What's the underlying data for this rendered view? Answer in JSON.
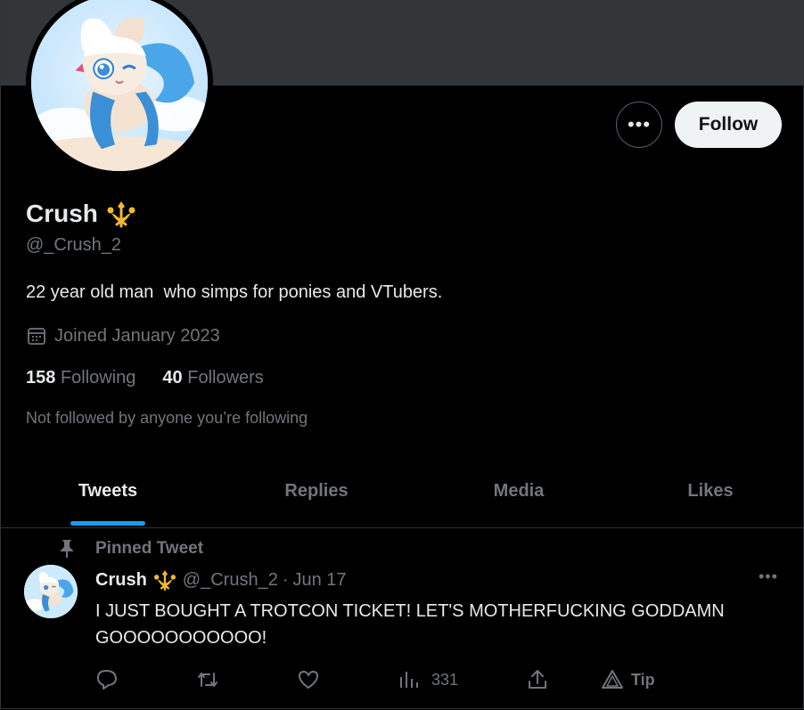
{
  "profile": {
    "display_name": "Crush",
    "handle": "@_Crush_2",
    "bio": "22 year old man  who simps for ponies and VTubers.",
    "joined": "Joined January 2023",
    "following_count": "158",
    "following_label": "Following",
    "followers_count": "40",
    "followers_label": "Followers",
    "not_followed_note": "Not followed by anyone you’re following",
    "avatar_icon": "pony-avatar-icon",
    "badge_icon": "crown-badge-icon"
  },
  "actions": {
    "more_icon": "•••",
    "follow_label": "Follow"
  },
  "tabs": [
    {
      "label": "Tweets",
      "active": true
    },
    {
      "label": "Replies",
      "active": false
    },
    {
      "label": "Media",
      "active": false
    },
    {
      "label": "Likes",
      "active": false
    }
  ],
  "pinned_tweet": {
    "pinned_label": "Pinned Tweet",
    "author_name": "Crush",
    "author_handle": "@_Crush_2",
    "separator": "·",
    "date": "Jun 17",
    "more_icon": "•••",
    "text": "I JUST BOUGHT A TROTCON TICKET! LET'S MOTHERFUCKING GODDAMN GOOOOOOOOOOO!",
    "views_count": "331",
    "tip_label": "Tip"
  },
  "colors": {
    "background": "#000000",
    "banner": "#333639",
    "primary_text": "#e7e9ea",
    "secondary_text": "#71767b",
    "accent": "#1d9bf0",
    "badge_gold": "#f5b82e",
    "follow_button_bg": "#eff3f4"
  }
}
